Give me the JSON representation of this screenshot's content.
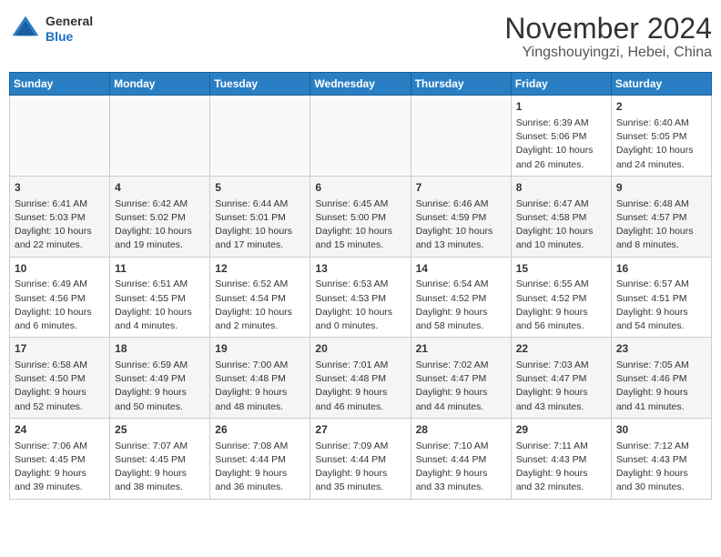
{
  "header": {
    "logo": {
      "general": "General",
      "blue": "Blue"
    },
    "title": "November 2024",
    "subtitle": "Yingshouyingzi, Hebei, China"
  },
  "calendar": {
    "weekdays": [
      "Sunday",
      "Monday",
      "Tuesday",
      "Wednesday",
      "Thursday",
      "Friday",
      "Saturday"
    ],
    "weeks": [
      [
        {
          "day": "",
          "info": ""
        },
        {
          "day": "",
          "info": ""
        },
        {
          "day": "",
          "info": ""
        },
        {
          "day": "",
          "info": ""
        },
        {
          "day": "",
          "info": ""
        },
        {
          "day": "1",
          "info": "Sunrise: 6:39 AM\nSunset: 5:06 PM\nDaylight: 10 hours and 26 minutes."
        },
        {
          "day": "2",
          "info": "Sunrise: 6:40 AM\nSunset: 5:05 PM\nDaylight: 10 hours and 24 minutes."
        }
      ],
      [
        {
          "day": "3",
          "info": "Sunrise: 6:41 AM\nSunset: 5:03 PM\nDaylight: 10 hours and 22 minutes."
        },
        {
          "day": "4",
          "info": "Sunrise: 6:42 AM\nSunset: 5:02 PM\nDaylight: 10 hours and 19 minutes."
        },
        {
          "day": "5",
          "info": "Sunrise: 6:44 AM\nSunset: 5:01 PM\nDaylight: 10 hours and 17 minutes."
        },
        {
          "day": "6",
          "info": "Sunrise: 6:45 AM\nSunset: 5:00 PM\nDaylight: 10 hours and 15 minutes."
        },
        {
          "day": "7",
          "info": "Sunrise: 6:46 AM\nSunset: 4:59 PM\nDaylight: 10 hours and 13 minutes."
        },
        {
          "day": "8",
          "info": "Sunrise: 6:47 AM\nSunset: 4:58 PM\nDaylight: 10 hours and 10 minutes."
        },
        {
          "day": "9",
          "info": "Sunrise: 6:48 AM\nSunset: 4:57 PM\nDaylight: 10 hours and 8 minutes."
        }
      ],
      [
        {
          "day": "10",
          "info": "Sunrise: 6:49 AM\nSunset: 4:56 PM\nDaylight: 10 hours and 6 minutes."
        },
        {
          "day": "11",
          "info": "Sunrise: 6:51 AM\nSunset: 4:55 PM\nDaylight: 10 hours and 4 minutes."
        },
        {
          "day": "12",
          "info": "Sunrise: 6:52 AM\nSunset: 4:54 PM\nDaylight: 10 hours and 2 minutes."
        },
        {
          "day": "13",
          "info": "Sunrise: 6:53 AM\nSunset: 4:53 PM\nDaylight: 10 hours and 0 minutes."
        },
        {
          "day": "14",
          "info": "Sunrise: 6:54 AM\nSunset: 4:52 PM\nDaylight: 9 hours and 58 minutes."
        },
        {
          "day": "15",
          "info": "Sunrise: 6:55 AM\nSunset: 4:52 PM\nDaylight: 9 hours and 56 minutes."
        },
        {
          "day": "16",
          "info": "Sunrise: 6:57 AM\nSunset: 4:51 PM\nDaylight: 9 hours and 54 minutes."
        }
      ],
      [
        {
          "day": "17",
          "info": "Sunrise: 6:58 AM\nSunset: 4:50 PM\nDaylight: 9 hours and 52 minutes."
        },
        {
          "day": "18",
          "info": "Sunrise: 6:59 AM\nSunset: 4:49 PM\nDaylight: 9 hours and 50 minutes."
        },
        {
          "day": "19",
          "info": "Sunrise: 7:00 AM\nSunset: 4:48 PM\nDaylight: 9 hours and 48 minutes."
        },
        {
          "day": "20",
          "info": "Sunrise: 7:01 AM\nSunset: 4:48 PM\nDaylight: 9 hours and 46 minutes."
        },
        {
          "day": "21",
          "info": "Sunrise: 7:02 AM\nSunset: 4:47 PM\nDaylight: 9 hours and 44 minutes."
        },
        {
          "day": "22",
          "info": "Sunrise: 7:03 AM\nSunset: 4:47 PM\nDaylight: 9 hours and 43 minutes."
        },
        {
          "day": "23",
          "info": "Sunrise: 7:05 AM\nSunset: 4:46 PM\nDaylight: 9 hours and 41 minutes."
        }
      ],
      [
        {
          "day": "24",
          "info": "Sunrise: 7:06 AM\nSunset: 4:45 PM\nDaylight: 9 hours and 39 minutes."
        },
        {
          "day": "25",
          "info": "Sunrise: 7:07 AM\nSunset: 4:45 PM\nDaylight: 9 hours and 38 minutes."
        },
        {
          "day": "26",
          "info": "Sunrise: 7:08 AM\nSunset: 4:44 PM\nDaylight: 9 hours and 36 minutes."
        },
        {
          "day": "27",
          "info": "Sunrise: 7:09 AM\nSunset: 4:44 PM\nDaylight: 9 hours and 35 minutes."
        },
        {
          "day": "28",
          "info": "Sunrise: 7:10 AM\nSunset: 4:44 PM\nDaylight: 9 hours and 33 minutes."
        },
        {
          "day": "29",
          "info": "Sunrise: 7:11 AM\nSunset: 4:43 PM\nDaylight: 9 hours and 32 minutes."
        },
        {
          "day": "30",
          "info": "Sunrise: 7:12 AM\nSunset: 4:43 PM\nDaylight: 9 hours and 30 minutes."
        }
      ]
    ]
  }
}
